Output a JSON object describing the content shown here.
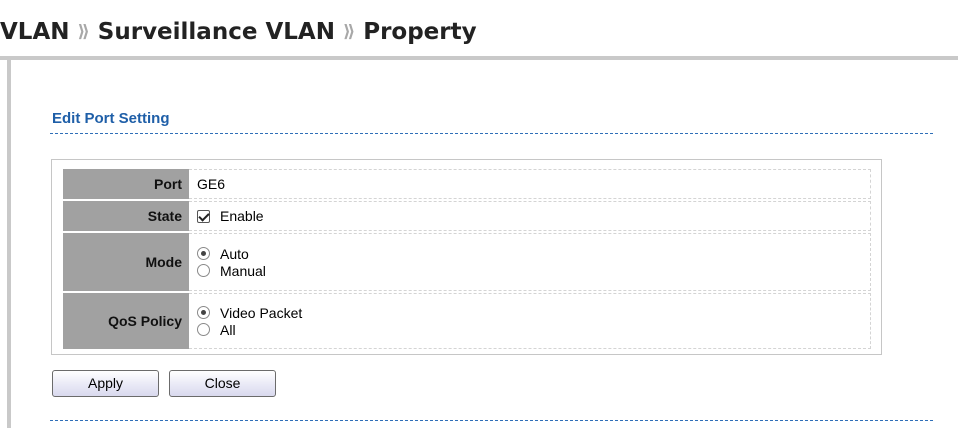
{
  "breadcrumb": {
    "items": [
      "VLAN",
      "Surveillance VLAN",
      "Property"
    ],
    "separator": "⟫"
  },
  "section": {
    "title": "Edit Port Setting"
  },
  "form": {
    "port": {
      "label": "Port",
      "value": "GE6"
    },
    "state": {
      "label": "State",
      "option": "Enable",
      "checked": true
    },
    "mode": {
      "label": "Mode",
      "options": [
        "Auto",
        "Manual"
      ],
      "selected": "Auto"
    },
    "qos": {
      "label": "QoS Policy",
      "options": [
        "Video Packet",
        "All"
      ],
      "selected": "Video Packet"
    }
  },
  "buttons": {
    "apply": "Apply",
    "close": "Close"
  },
  "colors": {
    "section_title": "#1f5fa8",
    "label_bg": "#a1a1a1",
    "divider": "#2f6fb8"
  }
}
